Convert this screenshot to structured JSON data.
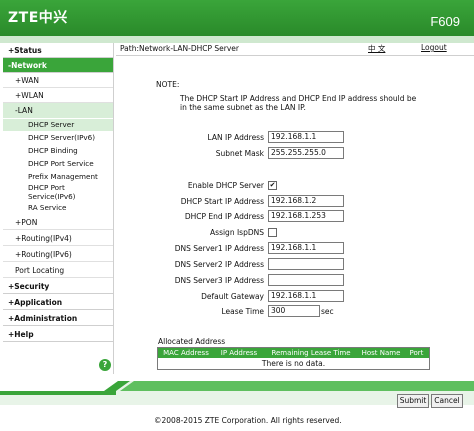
{
  "header": {
    "logo": "ZTE中兴",
    "model": "F609"
  },
  "nav": {
    "path": "Path:Network-LAN-DHCP Server",
    "lang": "中 文",
    "logout": "Logout"
  },
  "sidebar": {
    "status": "+Status",
    "network": "-Network",
    "wan": "+WAN",
    "wlan": "+WLAN",
    "lan": "-LAN",
    "dhcp_server": "DHCP Server",
    "dhcp_server_v6": "DHCP Server(IPv6)",
    "dhcp_binding": "DHCP Binding",
    "dhcp_port_service": "DHCP Port Service",
    "prefix_management": "Prefix Management",
    "dhcp_port_service_v6_line1": "DHCP Port",
    "dhcp_port_service_v6_line2": "Service(IPv6)",
    "ra_service": "RA Service",
    "pon": "+PON",
    "routing_v4": "+Routing(IPv4)",
    "routing_v6": "+Routing(IPv6)",
    "port_locating": "Port Locating",
    "security": "+Security",
    "application": "+Application",
    "administration": "+Administration",
    "help": "+Help",
    "help_icon": "?"
  },
  "note": {
    "title": "NOTE:",
    "text": "The DHCP Start IP Address and DHCP End IP address should be in the same subnet as the LAN IP."
  },
  "form": {
    "lan_ip_label": "LAN IP Address",
    "lan_ip_value": "192.168.1.1",
    "subnet_label": "Subnet Mask",
    "subnet_value": "255.255.255.0",
    "enable_dhcp_label": "Enable DHCP Server",
    "enable_dhcp_checked": "✔",
    "start_ip_label": "DHCP Start IP Address",
    "start_ip_value": "192.168.1.2",
    "end_ip_label": "DHCP End IP Address",
    "end_ip_value": "192.168.1.253",
    "assign_isp_label": "Assign IspDNS",
    "dns1_label": "DNS Server1 IP Address",
    "dns1_value": "192.168.1.1",
    "dns2_label": "DNS Server2 IP Address",
    "dns2_value": "",
    "dns3_label": "DNS Server3 IP Address",
    "dns3_value": "",
    "gateway_label": "Default Gateway",
    "gateway_value": "192.168.1.1",
    "lease_label": "Lease Time",
    "lease_value": "300",
    "lease_unit": "sec"
  },
  "allocated": {
    "title": "Allocated Address",
    "headers": [
      "MAC Address",
      "IP Address",
      "Remaining Lease Time",
      "Host Name",
      "Port"
    ],
    "empty": "There is no data."
  },
  "buttons": {
    "submit": "Submit",
    "cancel": "Cancel"
  },
  "footer": {
    "copyright": "©2008-2015 ZTE Corporation. All rights reserved."
  },
  "colors": {
    "brand_green": "#3aa53a",
    "light_green": "#d8eed8"
  }
}
